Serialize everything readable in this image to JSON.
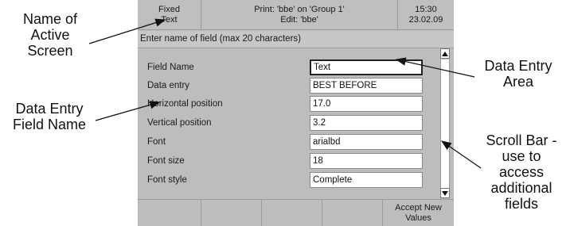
{
  "callouts": {
    "active_screen": [
      "Name of",
      "Active",
      "Screen"
    ],
    "field_name": [
      "Data Entry",
      "Field Name"
    ],
    "entry_area": [
      "Data Entry",
      "Area"
    ],
    "scroll_bar": [
      "Scroll Bar -",
      "use to",
      "access",
      "additional",
      "fields"
    ]
  },
  "status_bar": {
    "screen_name": [
      "Fixed",
      "Text"
    ],
    "job_info": [
      "Print: 'bbe' on 'Group 1'",
      "Edit: 'bbe'"
    ],
    "time": "15:30",
    "date": "23.02.09"
  },
  "hint": "Enter name of field (max 20 characters)",
  "fields": [
    {
      "label": "Field Name",
      "value": "Text"
    },
    {
      "label": "Data entry",
      "value": "BEST BEFORE"
    },
    {
      "label": "Horizontal position",
      "value": "17.0"
    },
    {
      "label": "Vertical position",
      "value": "3.2"
    },
    {
      "label": "Font",
      "value": "arialbd"
    },
    {
      "label": "Font size",
      "value": "18"
    },
    {
      "label": "Font style",
      "value": "Complete"
    }
  ],
  "softkeys": [
    [
      ""
    ],
    [
      ""
    ],
    [
      ""
    ],
    [
      ""
    ],
    [
      ""
    ],
    [
      "Accept New",
      "Values"
    ]
  ],
  "icons": {
    "scroll_up": "triangle-up-icon",
    "scroll_down": "triangle-down-icon"
  }
}
